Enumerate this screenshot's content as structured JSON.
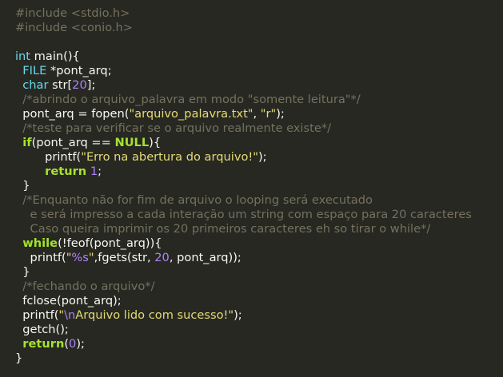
{
  "editor": {
    "background": "#272822",
    "lines": [
      [
        {
          "t": "#include <stdio.h>",
          "c": "preproc"
        }
      ],
      [
        {
          "t": "#include <conio.h>",
          "c": "preproc"
        }
      ],
      [
        {
          "t": "",
          "c": "plain"
        }
      ],
      [
        {
          "t": "int",
          "c": "type"
        },
        {
          "t": " main(){",
          "c": "plain"
        }
      ],
      [
        {
          "t": "  ",
          "c": "plain"
        },
        {
          "t": "FILE",
          "c": "type"
        },
        {
          "t": " *pont_arq;",
          "c": "plain"
        }
      ],
      [
        {
          "t": "  ",
          "c": "plain"
        },
        {
          "t": "char",
          "c": "type"
        },
        {
          "t": " str[",
          "c": "plain"
        },
        {
          "t": "20",
          "c": "number"
        },
        {
          "t": "];",
          "c": "plain"
        }
      ],
      [
        {
          "t": "  /*abrindo o arquivo_palavra em modo \"somente leitura\"*/",
          "c": "comment"
        }
      ],
      [
        {
          "t": "  pont_arq = fopen(",
          "c": "plain"
        },
        {
          "t": "\"arquivo_palavra.txt\"",
          "c": "string"
        },
        {
          "t": ", ",
          "c": "plain"
        },
        {
          "t": "\"r\"",
          "c": "string"
        },
        {
          "t": ");",
          "c": "plain"
        }
      ],
      [
        {
          "t": "  /*teste para verificar se o arquivo realmente existe*/",
          "c": "comment"
        }
      ],
      [
        {
          "t": "  ",
          "c": "plain"
        },
        {
          "t": "if",
          "c": "keyword"
        },
        {
          "t": "(pont_arq == ",
          "c": "plain"
        },
        {
          "t": "NULL",
          "c": "constant"
        },
        {
          "t": "){",
          "c": "plain"
        }
      ],
      [
        {
          "t": "        printf(",
          "c": "plain"
        },
        {
          "t": "\"Erro na abertura do arquivo!\"",
          "c": "string"
        },
        {
          "t": ");",
          "c": "plain"
        }
      ],
      [
        {
          "t": "        ",
          "c": "plain"
        },
        {
          "t": "return",
          "c": "keyword"
        },
        {
          "t": " ",
          "c": "plain"
        },
        {
          "t": "1",
          "c": "number"
        },
        {
          "t": ";",
          "c": "plain"
        }
      ],
      [
        {
          "t": "  }",
          "c": "plain"
        }
      ],
      [
        {
          "t": "  /*Enquanto não for fim de arquivo o looping será executado",
          "c": "comment"
        }
      ],
      [
        {
          "t": "    e será impresso a cada interação um string com espaço para 20 caracteres",
          "c": "comment"
        }
      ],
      [
        {
          "t": "    Caso queira imprimir os 20 primeiros caracteres eh so tirar o while*/",
          "c": "comment"
        }
      ],
      [
        {
          "t": "  ",
          "c": "plain"
        },
        {
          "t": "while",
          "c": "keyword"
        },
        {
          "t": "(!feof(pont_arq)){",
          "c": "plain"
        }
      ],
      [
        {
          "t": "    printf(",
          "c": "plain"
        },
        {
          "t": "\"",
          "c": "string"
        },
        {
          "t": "%s",
          "c": "format"
        },
        {
          "t": "\"",
          "c": "string"
        },
        {
          "t": ",fgets(str, ",
          "c": "plain"
        },
        {
          "t": "20",
          "c": "number"
        },
        {
          "t": ", pont_arq));",
          "c": "plain"
        }
      ],
      [
        {
          "t": "  }",
          "c": "plain"
        }
      ],
      [
        {
          "t": "  /*fechando o arquivo*/",
          "c": "comment"
        }
      ],
      [
        {
          "t": "  fclose(pont_arq);",
          "c": "plain"
        }
      ],
      [
        {
          "t": "  printf(",
          "c": "plain"
        },
        {
          "t": "\"",
          "c": "string"
        },
        {
          "t": "\\n",
          "c": "escape"
        },
        {
          "t": "Arquivo lido com sucesso!\"",
          "c": "string"
        },
        {
          "t": ");",
          "c": "plain"
        }
      ],
      [
        {
          "t": "  getch();",
          "c": "plain"
        }
      ],
      [
        {
          "t": "  ",
          "c": "plain"
        },
        {
          "t": "return",
          "c": "keyword"
        },
        {
          "t": "(",
          "c": "plain"
        },
        {
          "t": "0",
          "c": "number"
        },
        {
          "t": ");",
          "c": "plain"
        }
      ],
      [
        {
          "t": "}",
          "c": "plain"
        }
      ]
    ]
  }
}
